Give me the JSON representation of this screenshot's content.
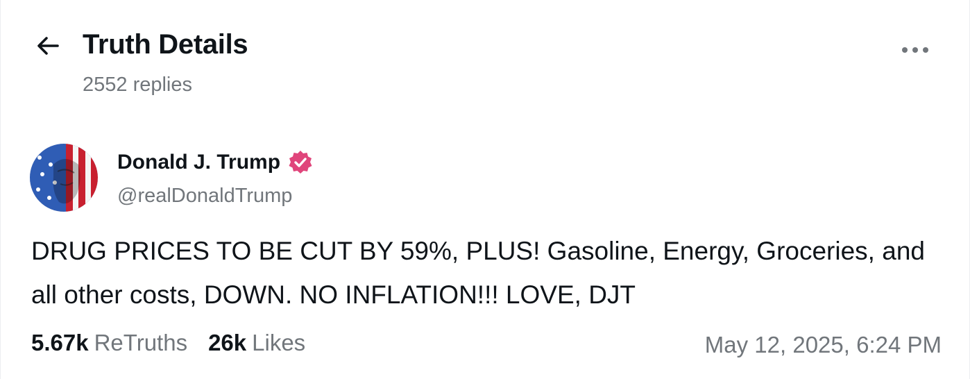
{
  "header": {
    "title": "Truth Details",
    "replies": "2552 replies",
    "back_icon": "arrow-left-icon",
    "more_icon": "more-horizontal-icon"
  },
  "post": {
    "author": {
      "name": "Donald J. Trump",
      "handle": "@realDonaldTrump",
      "verified_icon": "verified-badge-icon",
      "verified_color": "#e0457b"
    },
    "text": "DRUG PRICES TO BE CUT BY 59%, PLUS! Gasoline, Energy, Groceries, and all other costs, DOWN. NO INFLATION!!! LOVE, DJT",
    "retruths_count": "5.67k",
    "retruths_label": "ReTruths",
    "likes_count": "26k",
    "likes_label": "Likes",
    "timestamp": "May 12, 2025, 6:24 PM"
  }
}
